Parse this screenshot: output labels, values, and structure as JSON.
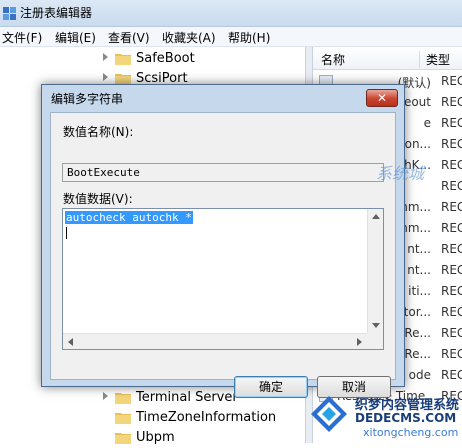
{
  "window": {
    "title": "注册表编辑器"
  },
  "menu": [
    "文件(F)",
    "编辑(E)",
    "查看(V)",
    "收藏夹(A)",
    "帮助(H)"
  ],
  "tree": {
    "items_top": [
      "SafeBoot",
      "ScsiPort"
    ],
    "items_bottom": [
      "Terminal Server",
      "TimeZoneInformation",
      "Ubpm"
    ]
  },
  "list": {
    "col_name": "名称",
    "col_type": "类型",
    "rows": [
      {
        "name": "(默认)",
        "type": "REG"
      },
      {
        "name": "eout",
        "type": "REG"
      },
      {
        "name": "e",
        "type": "REG"
      },
      {
        "name": "on...",
        "type": "REG"
      },
      {
        "name": "hK...",
        "type": "REG"
      },
      {
        "name": "",
        "type": "REG"
      },
      {
        "name": "mm...",
        "type": "REG"
      },
      {
        "name": "mm...",
        "type": "REG"
      },
      {
        "name": "nt...",
        "type": "REG"
      },
      {
        "name": "nt...",
        "type": "REG"
      },
      {
        "name": "iti...",
        "type": "REG"
      },
      {
        "name": "tor...",
        "type": "REG"
      },
      {
        "name": "Re...",
        "type": "REG"
      },
      {
        "name": "Re...",
        "type": "REG"
      },
      {
        "name": "ode",
        "type": "REG"
      },
      {
        "name": "Resource Time...",
        "type": "REG"
      }
    ]
  },
  "dialog": {
    "title": "编辑多字符串",
    "close_label": "✕",
    "name_label": "数值名称(N):",
    "name_value": "BootExecute",
    "data_label": "数值数据(V):",
    "data_value": "autocheck autochk *",
    "ok_label": "确定",
    "cancel_label": "取消"
  },
  "watermark": {
    "line1": "织梦内容管理系统",
    "line2": "DEDECMS.COM",
    "line3": "xitongcheng.com",
    "brand": "系统城"
  },
  "colors": {
    "selection": "#3399ff",
    "close": "#c9442f",
    "accent": "#3c7fb1"
  }
}
